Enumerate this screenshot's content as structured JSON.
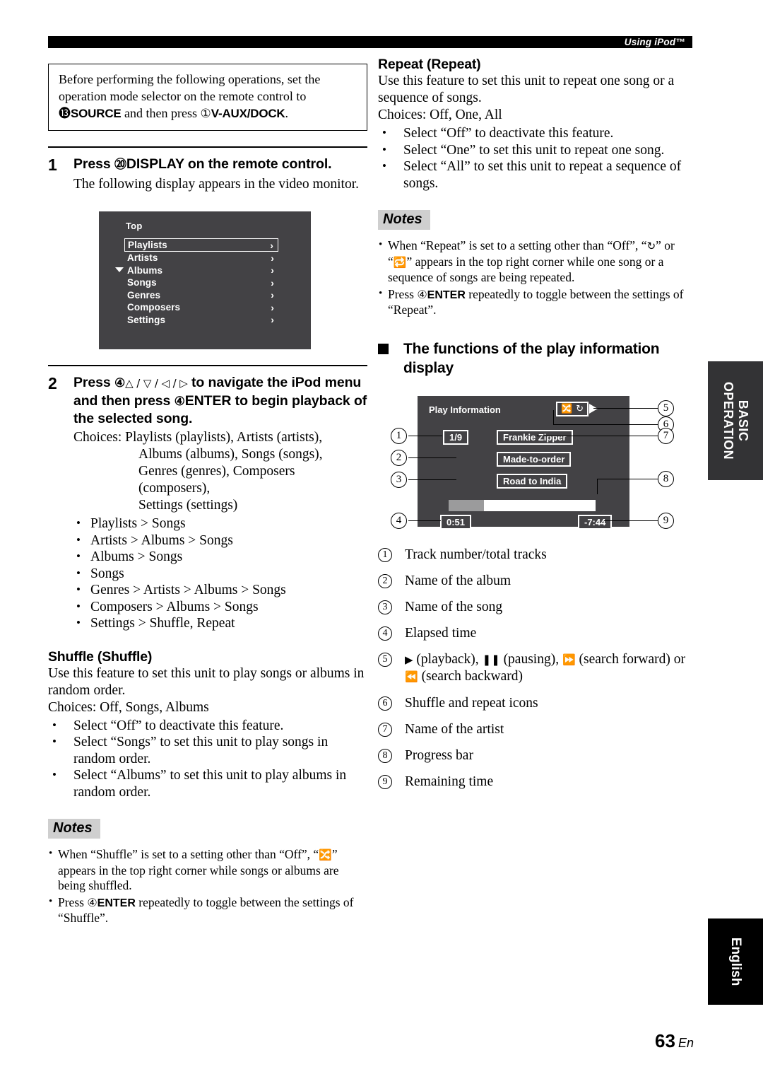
{
  "header": {
    "title": "Using iPod™"
  },
  "footer": {
    "page": "63",
    "lang": "En"
  },
  "side_tabs": {
    "basic": "BASIC\nOPERATION",
    "basic_line1": "BASIC",
    "basic_line2": "OPERATION",
    "english": "English"
  },
  "left": {
    "notice": {
      "part1": "Before performing the following operations, set the operation mode selector on the remote control to ",
      "ref1": "⓭",
      "bold1": "SOURCE",
      "part2": " and then press ",
      "ref2": "①",
      "bold2": "V-AUX/DOCK",
      "part3": "."
    },
    "step1": {
      "num": "1",
      "head_pre": "Press ",
      "head_ref": "⑳",
      "head_bold": "DISPLAY",
      "head_post": " on the remote control.",
      "sub": "The following display appears in the video monitor."
    },
    "ipod_menu": {
      "title": "Top",
      "items": [
        {
          "label": "Playlists",
          "chevron": "›",
          "selected": true
        },
        {
          "label": "Artists",
          "chevron": "›",
          "selected": false
        },
        {
          "label": "Albums",
          "chevron": "›",
          "selected": false
        },
        {
          "label": "Songs",
          "chevron": "›",
          "selected": false
        },
        {
          "label": "Genres",
          "chevron": "›",
          "selected": false
        },
        {
          "label": "Composers",
          "chevron": "›",
          "selected": false
        },
        {
          "label": "Settings",
          "chevron": "›",
          "selected": false
        }
      ]
    },
    "step2": {
      "num": "2",
      "head_pre": "Press ",
      "head_ref": "④",
      "head_keys": "△ / ▽ / ◁ / ▷",
      "head_mid": " to navigate the iPod menu and then press ",
      "head_ref2": "④",
      "head_bold": "ENTER",
      "head_post": " to begin playback of the selected song.",
      "choices_label": "Choices: ",
      "choices_line1": "Playlists (playlists), Artists (artists),",
      "choices_line2": "Albums (albums), Songs (songs),",
      "choices_line3": "Genres (genres), Composers (composers),",
      "choices_line4": "Settings (settings)",
      "paths": [
        "Playlists > Songs",
        "Artists > Albums > Songs",
        "Albums > Songs",
        "Songs",
        "Genres > Artists > Albums > Songs",
        "Composers > Albums > Songs",
        "Settings > Shuffle, Repeat"
      ]
    },
    "shuffle": {
      "heading": "Shuffle (Shuffle)",
      "desc": "Use this feature to set this unit to play songs or albums in random order.",
      "choices": "Choices: Off, Songs, Albums",
      "bullets": [
        "Select “Off” to deactivate this feature.",
        "Select “Songs” to set this unit to play songs in random order.",
        "Select “Albums” to set this unit to play albums in random order."
      ],
      "notes_label": "Notes",
      "note1_pre": "When “Shuffle” is set to a setting other than “Off”, “",
      "note1_icon": "shuffle-icon",
      "note1_post": "” appears in the top right corner while songs or albums are being shuffled.",
      "note2_pre": "Press ",
      "note2_ref": "④",
      "note2_bold": "ENTER",
      "note2_post": " repeatedly to toggle between the settings of “Shuffle”."
    }
  },
  "right": {
    "repeat": {
      "heading": "Repeat (Repeat)",
      "desc": "Use this feature to set this unit to repeat one song or a sequence of songs.",
      "choices": "Choices: Off, One, All",
      "bullets": [
        "Select “Off” to deactivate this feature.",
        "Select “One” to set this unit to repeat one song.",
        "Select “All” to set this unit to repeat a sequence of songs."
      ],
      "notes_label": "Notes",
      "note1_pre": "When “Repeat” is set to a setting other than “Off”, “",
      "note1_icon_a": "repeat-all-icon",
      "note1_mid": "” or “",
      "note1_icon_b": "repeat-one-icon",
      "note1_post": "” appears in the top right corner while one song or a sequence of songs are being repeated.",
      "note2_pre": "Press ",
      "note2_ref": "④",
      "note2_bold": "ENTER",
      "note2_post": " repeatedly to toggle between the settings of “Repeat”."
    },
    "play_info_heading": "The functions of the play information display",
    "play_info_display": {
      "label": "Play Information",
      "track": "1/9",
      "artist": "Frankie Zipper",
      "album": "Made-to-order",
      "song": "Road to India",
      "elapsed": "0:51",
      "remaining": "-7:44",
      "progress_percent": 24,
      "shuffle_icon": "shuffle-icon",
      "repeat_icon": "repeat-icon",
      "play_icon": "play-icon",
      "callouts": [
        "1",
        "2",
        "3",
        "4",
        "5",
        "6",
        "7",
        "8",
        "9"
      ]
    },
    "legend": [
      {
        "num": "①",
        "text": "Track number/total tracks"
      },
      {
        "num": "②",
        "text": "Name of the album"
      },
      {
        "num": "③",
        "text": "Name of the song"
      },
      {
        "num": "④",
        "text": "Elapsed time"
      },
      {
        "num": "⑤",
        "text": "(playback), (pausing), (search forward) or (search backward)"
      },
      {
        "num": "⑥",
        "text": "Shuffle and repeat icons"
      },
      {
        "num": "⑦",
        "text": "Name of the artist"
      },
      {
        "num": "⑧",
        "text": "Progress bar"
      },
      {
        "num": "⑨",
        "text": "Remaining time"
      }
    ],
    "legend5": {
      "play_glyph": "▶",
      "play_word": "(playback),",
      "pause_glyph": "❚❚",
      "pause_word": "(pausing),",
      "ff_glyph": "⏩",
      "ff_word": "(search forward) or",
      "rw_glyph": "⏪",
      "rw_word": "(search backward)"
    }
  }
}
